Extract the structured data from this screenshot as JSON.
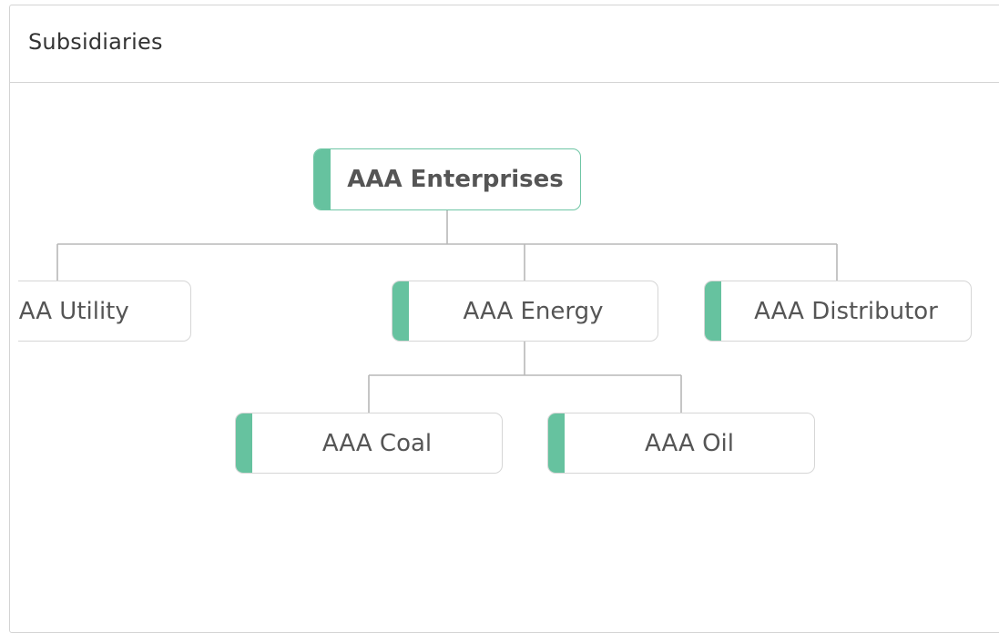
{
  "panel": {
    "title": "Subsidiaries"
  },
  "colors": {
    "accent": "#66c29f",
    "connector": "#b8b8b8"
  },
  "org_chart": {
    "root": "AAA Enterprises",
    "children": [
      {
        "name": "AAA Utility"
      },
      {
        "name": "AAA Energy",
        "children": [
          {
            "name": "AAA Coal"
          },
          {
            "name": "AAA Oil"
          }
        ]
      },
      {
        "name": "AAA Distributor"
      }
    ]
  },
  "nodes": {
    "enterprises": "AAA Enterprises",
    "utility": "AAA Utility",
    "energy": "AAA Energy",
    "distributor": "AAA Distributor",
    "coal": "AAA Coal",
    "oil": "AAA Oil"
  }
}
